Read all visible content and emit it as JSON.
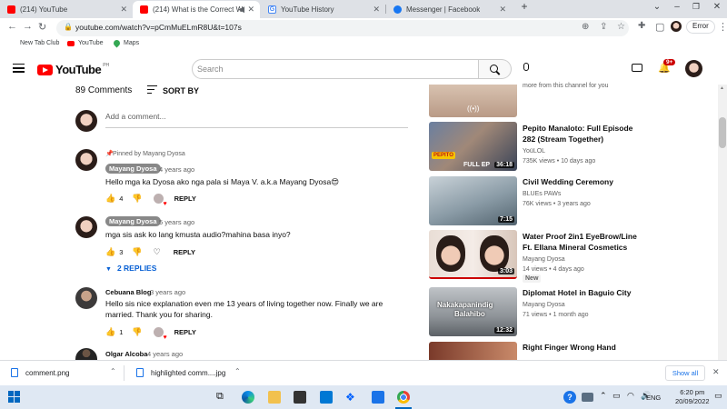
{
  "browser": {
    "tabs": [
      {
        "title": "(214) YouTube",
        "favicon_color": "#ff0000"
      },
      {
        "title": "(214) What is the Correct W",
        "favicon_color": "#ff0000"
      },
      {
        "title": "YouTube History",
        "favicon_color": "#4285f4"
      },
      {
        "title": "Messenger | Facebook",
        "favicon_color": "#1877f2"
      }
    ],
    "url": "youtube.com/watch?v=pCmMuELmR8U&t=107s",
    "profile_button": "Error",
    "bookmarks": [
      "New Tab Club",
      "YouTube",
      "Maps"
    ]
  },
  "youtube": {
    "logo_text": "YouTube",
    "region": "PH",
    "search_placeholder": "Search",
    "notification_count": "9+"
  },
  "comments": {
    "count_label": "89 Comments",
    "sort_label": "SORT BY",
    "add_placeholder": "Add a comment...",
    "items": [
      {
        "pinned_label": "Pinned by Mayang Dyosa",
        "author": "Mayang Dyosa",
        "time": "4 years ago",
        "text": "Hello mga ka Dyosa ako nga pala si Maya V. a.k.a Mayang Dyosa😍",
        "likes": "4",
        "reply": "REPLY"
      },
      {
        "author": "Mayang Dyosa",
        "time": "5 years ago",
        "text": "mga sis ask ko lang kmusta audio?mahina basa inyo?",
        "likes": "3",
        "reply": "REPLY",
        "replies_label": "2 REPLIES"
      },
      {
        "author": "Cebuana Blog",
        "time": "3 years ago",
        "text_line1": "Hello sis nice explanation even me 13 years of living together  now. Finally we are",
        "text_line2": "married. Thank you for sharing.",
        "likes": "1",
        "reply": "REPLY"
      },
      {
        "author": "Olgar Alcoba",
        "time": "4 years ago"
      }
    ]
  },
  "sidebar": {
    "top_partial_meta": "more from this channel for you",
    "videos": [
      {
        "title1": "Pepito Manaloto: Full Episode",
        "title2": "282 (Stream Together)",
        "channel": "YoüLOL",
        "meta": "735K views • 10 days ago",
        "duration": "36:18"
      },
      {
        "title1": "Civil Wedding Ceremony",
        "channel": "BLUEs PAWs",
        "meta": "76K views • 3 years ago",
        "duration": "7:15"
      },
      {
        "title1": "Water Proof 2in1 EyeBrow/Line",
        "title2": "Ft. Ellana Mineral Cosmetics",
        "channel": "Mayang Dyosa",
        "meta": "14 views • 4 days ago",
        "badge": "New",
        "duration": "3:03"
      },
      {
        "title1": "Diplomat Hotel in Baguio City",
        "channel": "Mayang Dyosa",
        "meta": "71 views • 1 month ago",
        "duration": "12:32",
        "thumb_text1": "Nakakapanindig",
        "thumb_text2": "Balahibo"
      },
      {
        "title1": "Right Finger Wrong Hand"
      }
    ]
  },
  "downloads": {
    "items": [
      "comment.png",
      "highlighted comm....jpg"
    ],
    "show_all": "Show all"
  },
  "taskbar": {
    "language": "ENG",
    "time": "6:20 pm",
    "date": "20/09/2022"
  }
}
